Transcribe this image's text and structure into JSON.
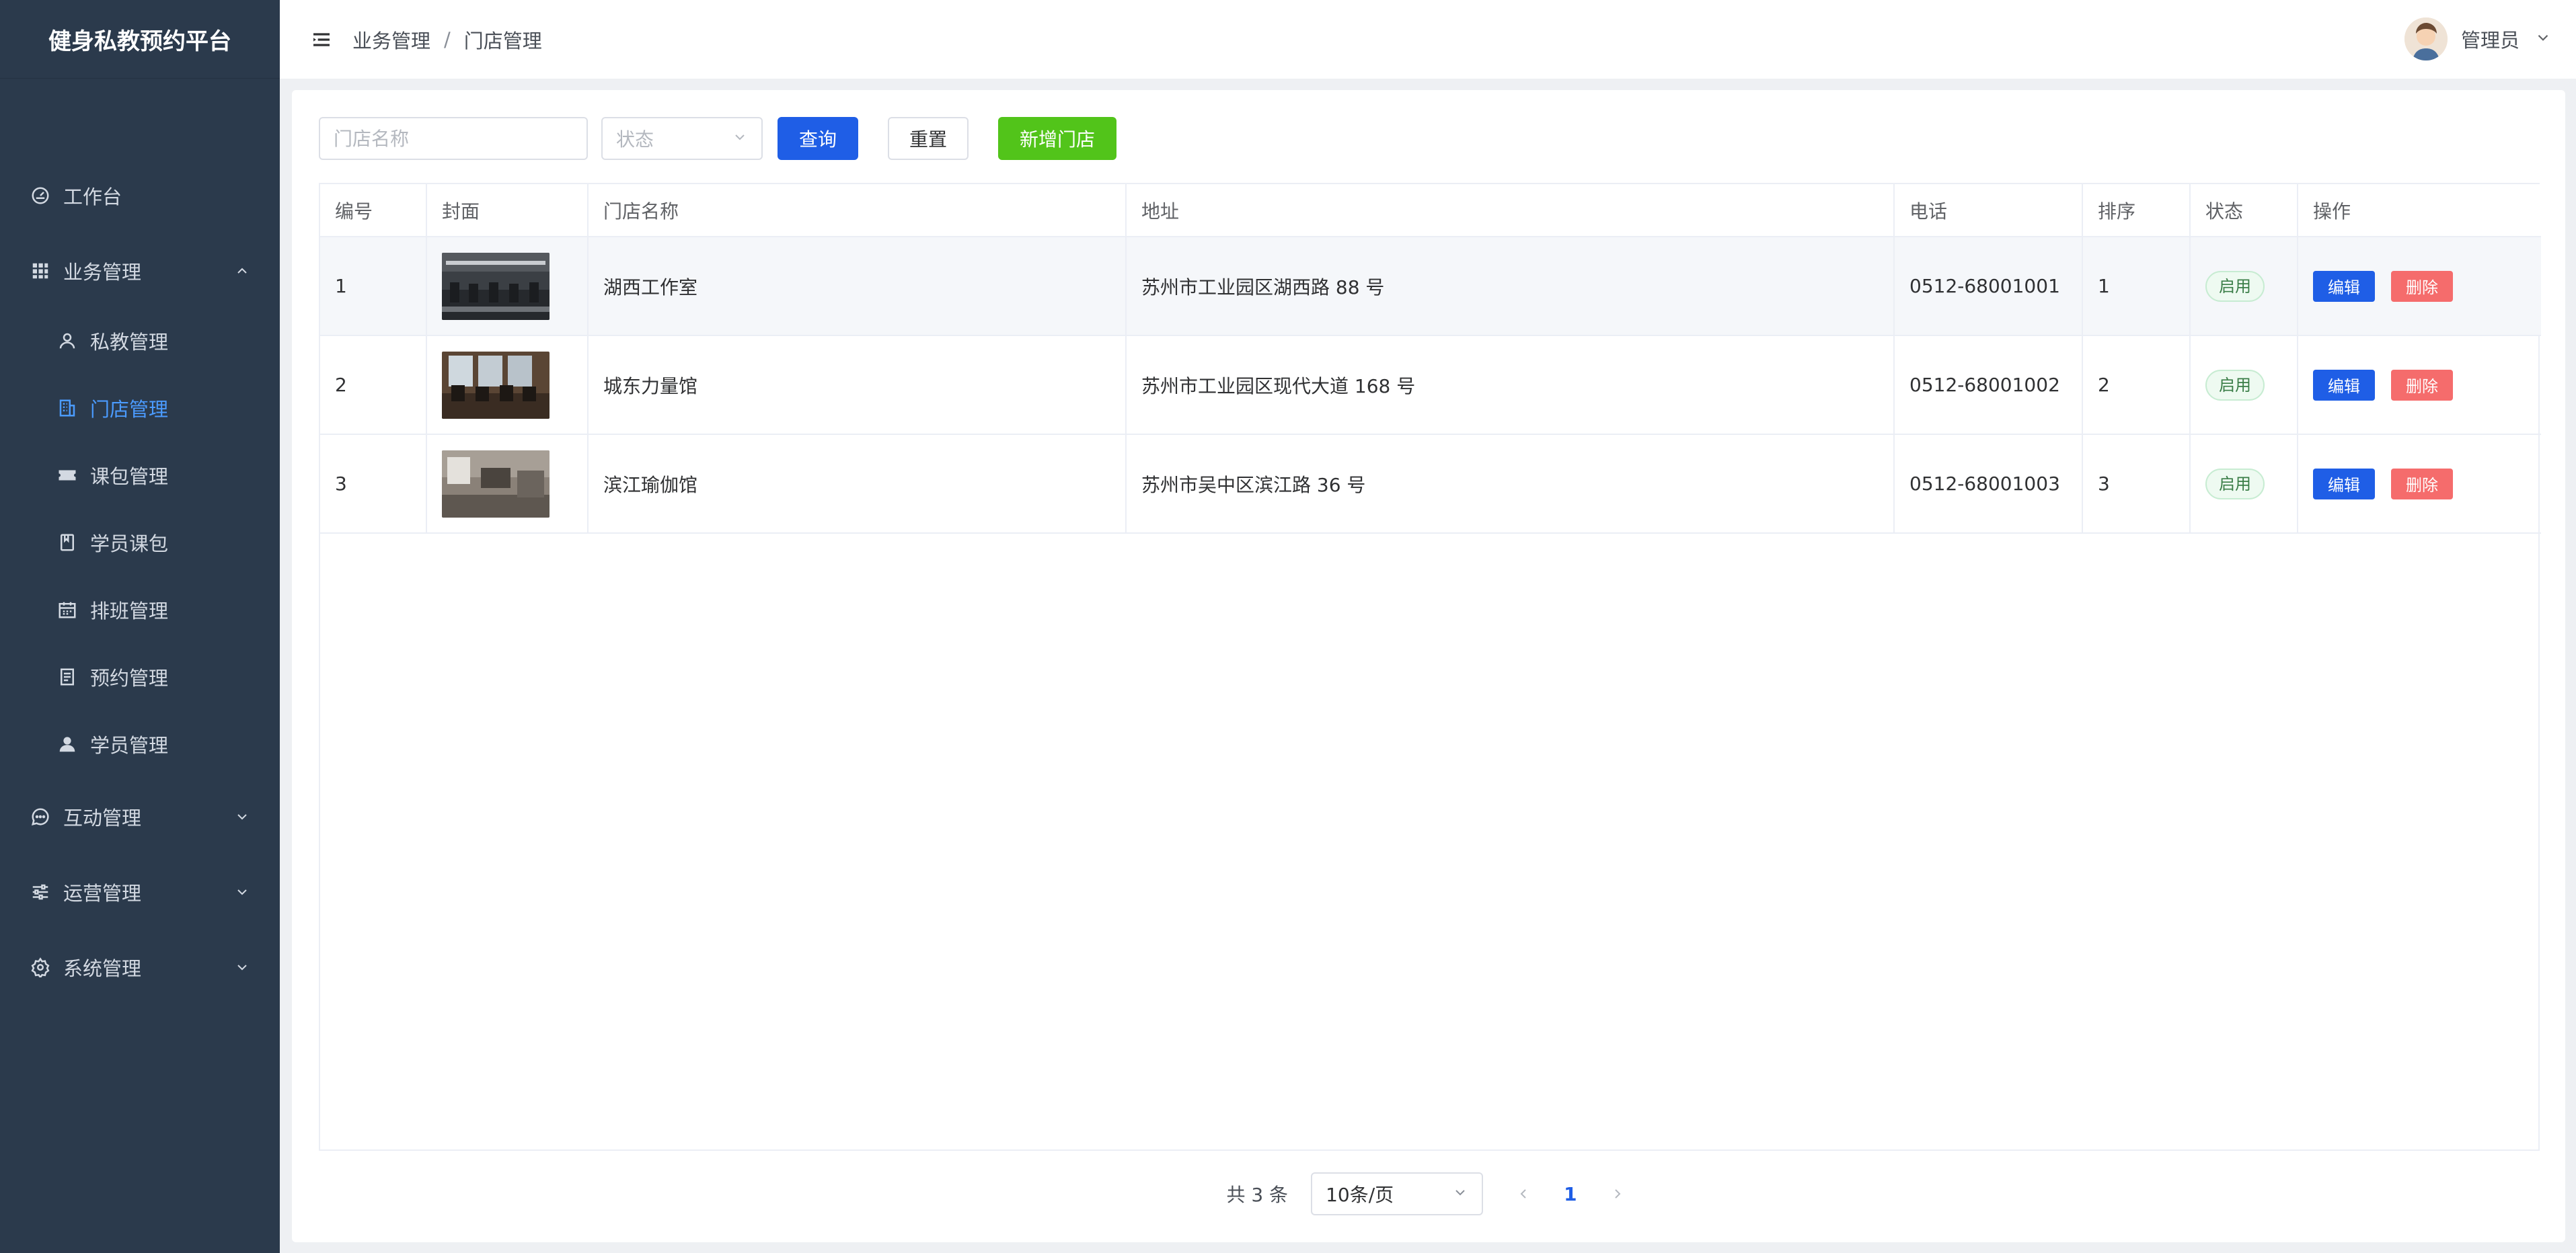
{
  "app": {
    "title": "健身私教预约平台"
  },
  "sidebar": {
    "items": [
      {
        "label": "工作台",
        "icon": "dashboard-icon"
      },
      {
        "label": "业务管理",
        "icon": "grid-icon",
        "expanded": true,
        "children": [
          {
            "label": "私教管理",
            "icon": "person-icon"
          },
          {
            "label": "门店管理",
            "icon": "building-icon",
            "active": true
          },
          {
            "label": "课包管理",
            "icon": "ticket-icon"
          },
          {
            "label": "学员课包",
            "icon": "notebook-icon"
          },
          {
            "label": "排班管理",
            "icon": "calendar-icon"
          },
          {
            "label": "预约管理",
            "icon": "document-icon"
          },
          {
            "label": "学员管理",
            "icon": "user-icon"
          }
        ]
      },
      {
        "label": "互动管理",
        "icon": "chat-icon",
        "expanded": false
      },
      {
        "label": "运营管理",
        "icon": "sliders-icon",
        "expanded": false
      },
      {
        "label": "系统管理",
        "icon": "gear-icon",
        "expanded": false
      }
    ],
    "active_color": "#4b9bff"
  },
  "header": {
    "breadcrumb": [
      "业务管理",
      "门店管理"
    ],
    "separator": "/",
    "user": "管理员"
  },
  "filter": {
    "name_placeholder": "门店名称",
    "status_placeholder": "状态",
    "query_label": "查询",
    "reset_label": "重置",
    "add_label": "新增门店"
  },
  "table": {
    "columns": [
      "编号",
      "封面",
      "门店名称",
      "地址",
      "电话",
      "排序",
      "状态",
      "操作"
    ],
    "rows": [
      {
        "id": "1",
        "name": "湖西工作室",
        "address": "苏州市工业园区湖西路 88 号",
        "phone": "0512-68001001",
        "sort": "1",
        "status": "启用",
        "edit": "编辑",
        "delete": "删除"
      },
      {
        "id": "2",
        "name": "城东力量馆",
        "address": "苏州市工业园区现代大道 168 号",
        "phone": "0512-68001002",
        "sort": "2",
        "status": "启用",
        "edit": "编辑",
        "delete": "删除"
      },
      {
        "id": "3",
        "name": "滨江瑜伽馆",
        "address": "苏州市吴中区滨江路 36 号",
        "phone": "0512-68001003",
        "sort": "3",
        "status": "启用",
        "edit": "编辑",
        "delete": "删除"
      }
    ]
  },
  "pagination": {
    "total": "共 3 条",
    "page_size": "10条/页",
    "current": "1"
  },
  "colors": {
    "sidebar_bg": "#2b3a4c",
    "primary": "#1f5ee6",
    "success": "#52c41a",
    "danger": "#f56c6c"
  }
}
